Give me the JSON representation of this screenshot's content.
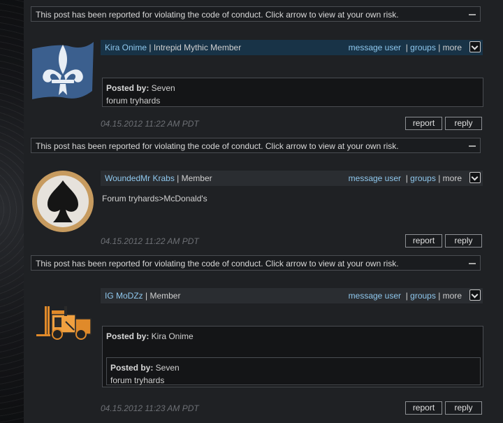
{
  "notice_text": "This post has been reported for violating the code of conduct. Click arrow to view at your own risk.",
  "links": {
    "message": "message user",
    "groups": "groups",
    "more": "more"
  },
  "buttons": {
    "report": "report",
    "reply": "reply"
  },
  "posts": [
    {
      "username": "Kira Onime",
      "rank": " | Intrepid Mythic Member",
      "avatar_icon": "fleur-de-lis-icon",
      "quote": {
        "posted_by_label": "Posted by:",
        "author": " Seven",
        "text": "forum tryhards"
      },
      "timestamp": "04.15.2012 11:22 AM PDT"
    },
    {
      "username": "WoundedMr Krabs",
      "rank": " | Member",
      "avatar_icon": "spade-icon",
      "body": "Forum tryhards>McDonald's",
      "timestamp": "04.15.2012 11:22 AM PDT"
    },
    {
      "username": "IG MoDZz",
      "rank": " | Member",
      "avatar_icon": "forklift-icon",
      "quote": {
        "posted_by_label": "Posted by:",
        "author": " Kira Onime",
        "nested": {
          "posted_by_label": "Posted by:",
          "author": " Seven",
          "text": "forum tryhards"
        }
      },
      "timestamp": "04.15.2012 11:23 AM PDT"
    }
  ],
  "colors": {
    "link": "#8fc8ee",
    "highlight_bar": "#183347",
    "background": "#1f2124"
  }
}
